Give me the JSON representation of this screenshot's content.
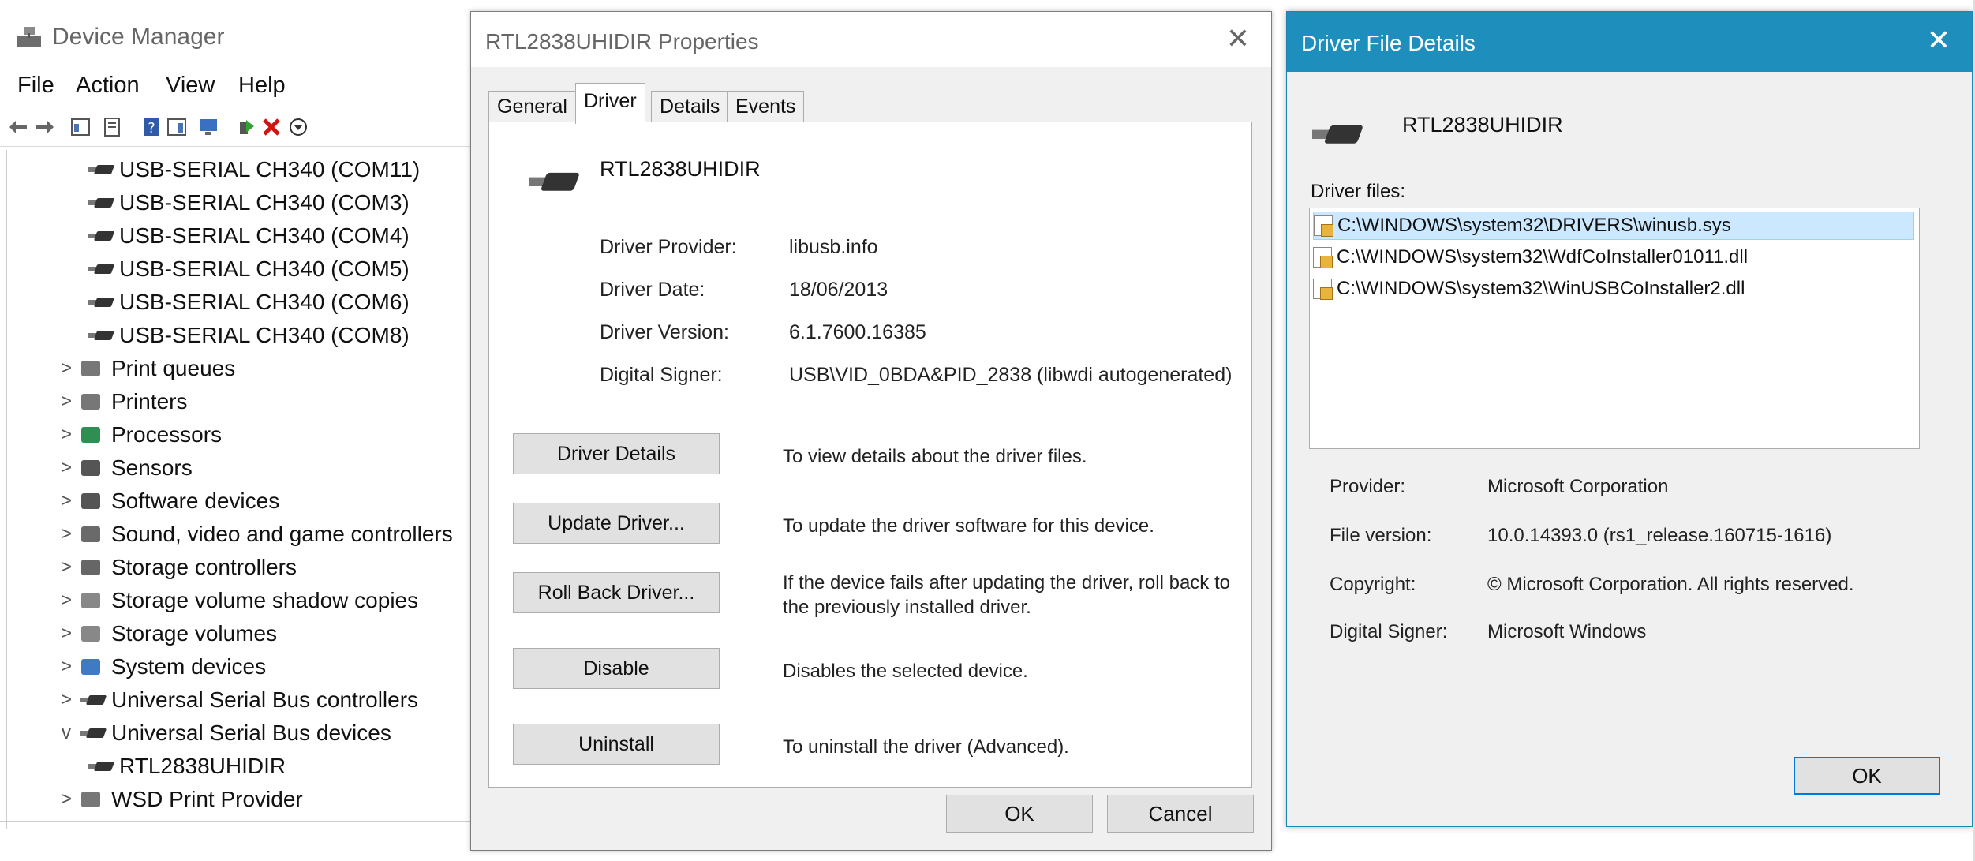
{
  "device_manager": {
    "title": "Device Manager",
    "menu": [
      "File",
      "Action",
      "View",
      "Help"
    ],
    "tree": [
      {
        "label": "USB-SERIAL CH340 (COM11)",
        "indent": 2,
        "expander": "",
        "icon": "usb-plug-icon"
      },
      {
        "label": "USB-SERIAL CH340 (COM3)",
        "indent": 2,
        "expander": "",
        "icon": "usb-plug-icon"
      },
      {
        "label": "USB-SERIAL CH340 (COM4)",
        "indent": 2,
        "expander": "",
        "icon": "usb-plug-icon"
      },
      {
        "label": "USB-SERIAL CH340 (COM5)",
        "indent": 2,
        "expander": "",
        "icon": "usb-plug-icon"
      },
      {
        "label": "USB-SERIAL CH340 (COM6)",
        "indent": 2,
        "expander": "",
        "icon": "usb-plug-icon"
      },
      {
        "label": "USB-SERIAL CH340 (COM8)",
        "indent": 2,
        "expander": "",
        "icon": "usb-plug-icon"
      },
      {
        "label": "Print queues",
        "indent": 1,
        "expander": ">",
        "icon": "printer-icon"
      },
      {
        "label": "Printers",
        "indent": 1,
        "expander": ">",
        "icon": "printer-icon"
      },
      {
        "label": "Processors",
        "indent": 1,
        "expander": ">",
        "icon": "processor-icon"
      },
      {
        "label": "Sensors",
        "indent": 1,
        "expander": ">",
        "icon": "sensor-icon"
      },
      {
        "label": "Software devices",
        "indent": 1,
        "expander": ">",
        "icon": "software-device-icon"
      },
      {
        "label": "Sound, video and game controllers",
        "indent": 1,
        "expander": ">",
        "icon": "speaker-icon"
      },
      {
        "label": "Storage controllers",
        "indent": 1,
        "expander": ">",
        "icon": "storage-controller-icon"
      },
      {
        "label": "Storage volume shadow copies",
        "indent": 1,
        "expander": ">",
        "icon": "drive-icon"
      },
      {
        "label": "Storage volumes",
        "indent": 1,
        "expander": ">",
        "icon": "drive-icon"
      },
      {
        "label": "System devices",
        "indent": 1,
        "expander": ">",
        "icon": "system-device-icon"
      },
      {
        "label": "Universal Serial Bus controllers",
        "indent": 1,
        "expander": ">",
        "icon": "usb-plug-icon"
      },
      {
        "label": "Universal Serial Bus devices",
        "indent": 1,
        "expander": "v",
        "icon": "usb-plug-icon"
      },
      {
        "label": "RTL2838UHIDIR",
        "indent": 2,
        "expander": "",
        "icon": "usb-plug-icon"
      },
      {
        "label": "WSD Print Provider",
        "indent": 1,
        "expander": ">",
        "icon": "printer-icon"
      }
    ]
  },
  "properties": {
    "title": "RTL2838UHIDIR Properties",
    "tabs": [
      "General",
      "Driver",
      "Details",
      "Events"
    ],
    "active_tab": "Driver",
    "device_name": "RTL2838UHIDIR",
    "info": [
      {
        "label": "Driver Provider:",
        "value": "libusb.info"
      },
      {
        "label": "Driver Date:",
        "value": "18/06/2013"
      },
      {
        "label": "Driver Version:",
        "value": "6.1.7600.16385"
      },
      {
        "label": "Digital Signer:",
        "value": "USB\\VID_0BDA&PID_2838 (libwdi autogenerated)"
      }
    ],
    "actions": [
      {
        "button": "Driver Details",
        "desc": "To view details about the driver files."
      },
      {
        "button": "Update Driver...",
        "desc": "To update the driver software for this device."
      },
      {
        "button": "Roll Back Driver...",
        "desc": "If the device fails after updating the driver, roll back to the previously installed driver."
      },
      {
        "button": "Disable",
        "desc": "Disables the selected device."
      },
      {
        "button": "Uninstall",
        "desc": "To uninstall the driver (Advanced)."
      }
    ],
    "ok_label": "OK",
    "cancel_label": "Cancel",
    "close_glyph": "✕"
  },
  "driver_file_details": {
    "title": "Driver File Details",
    "close_glyph": "✕",
    "device_name": "RTL2838UHIDIR",
    "files_label": "Driver files:",
    "files": [
      "C:\\WINDOWS\\system32\\DRIVERS\\winusb.sys",
      "C:\\WINDOWS\\system32\\WdfCoInstaller01011.dll",
      "C:\\WINDOWS\\system32\\WinUSBCoInstaller2.dll"
    ],
    "selected_file_index": 0,
    "details": [
      {
        "label": "Provider:",
        "value": "Microsoft Corporation"
      },
      {
        "label": "File version:",
        "value": "10.0.14393.0 (rs1_release.160715-1616)"
      },
      {
        "label": "Copyright:",
        "value": "© Microsoft Corporation. All rights reserved."
      },
      {
        "label": "Digital Signer:",
        "value": "Microsoft Windows"
      }
    ],
    "ok_label": "OK"
  },
  "colors": {
    "accent_titlebar": "#1e8fbd",
    "selection": "#cce8ff",
    "button_face": "#e1e1e1",
    "dialog_face": "#f0f0f0"
  }
}
